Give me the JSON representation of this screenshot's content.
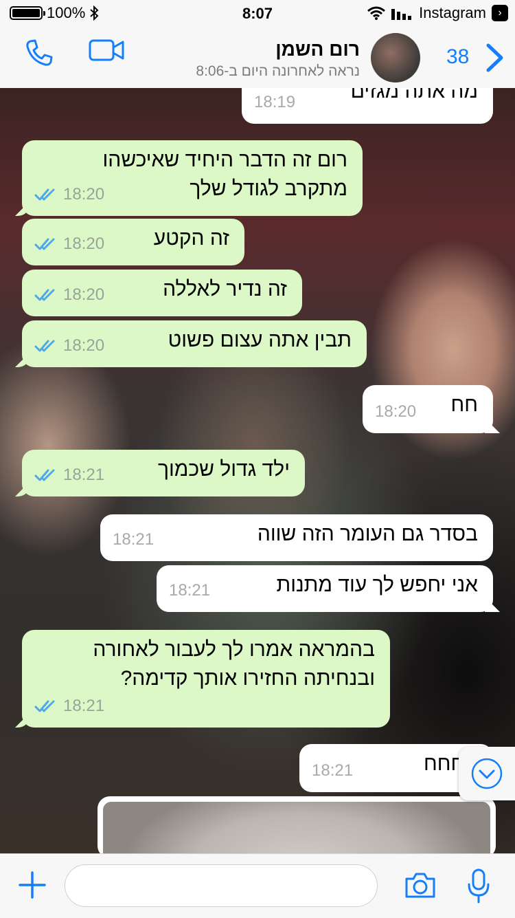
{
  "status_bar": {
    "battery": "100%",
    "time": "8:07",
    "back_app": "Instagram"
  },
  "header": {
    "contact_name": "רום השמן",
    "last_seen": "נראה לאחרונה היום ב-8:06",
    "unread_count": "38"
  },
  "messages": [
    {
      "dir": "in",
      "text": "מה אתה מגזים",
      "time": "18:19"
    },
    {
      "dir": "out",
      "text": "רום זה הדבר היחיד שאיכשהו\nמתקרב לגודל שלך",
      "time": "18:20",
      "read": true
    },
    {
      "dir": "out",
      "text": "זה הקטע",
      "time": "18:20",
      "read": true
    },
    {
      "dir": "out",
      "text": "זה נדיר לאללה",
      "time": "18:20",
      "read": true
    },
    {
      "dir": "out",
      "text": "תבין אתה עצום פשוט",
      "time": "18:20",
      "read": true
    },
    {
      "dir": "in",
      "text": "חח",
      "time": "18:20"
    },
    {
      "dir": "out",
      "text": "ילד גדול שכמוך",
      "time": "18:21",
      "read": true
    },
    {
      "dir": "in",
      "text": "בסדר גם העומר הזה שווה",
      "time": "18:21"
    },
    {
      "dir": "in",
      "text": "אני יחפש לך עוד מתנות",
      "time": "18:21"
    },
    {
      "dir": "out",
      "text": "בהמראה אמרו לך לעבור לאחורה\nובנחיתה החזירו אותך קדימה?",
      "time": "18:21",
      "read": true
    },
    {
      "dir": "in",
      "text": "חחחח",
      "time": "18:21"
    }
  ],
  "input": {
    "placeholder": ""
  },
  "colors": {
    "accent": "#147efb",
    "outgoing_bubble": "#dcf8c6",
    "incoming_bubble": "#ffffff",
    "read_tick": "#4fa8e8"
  }
}
